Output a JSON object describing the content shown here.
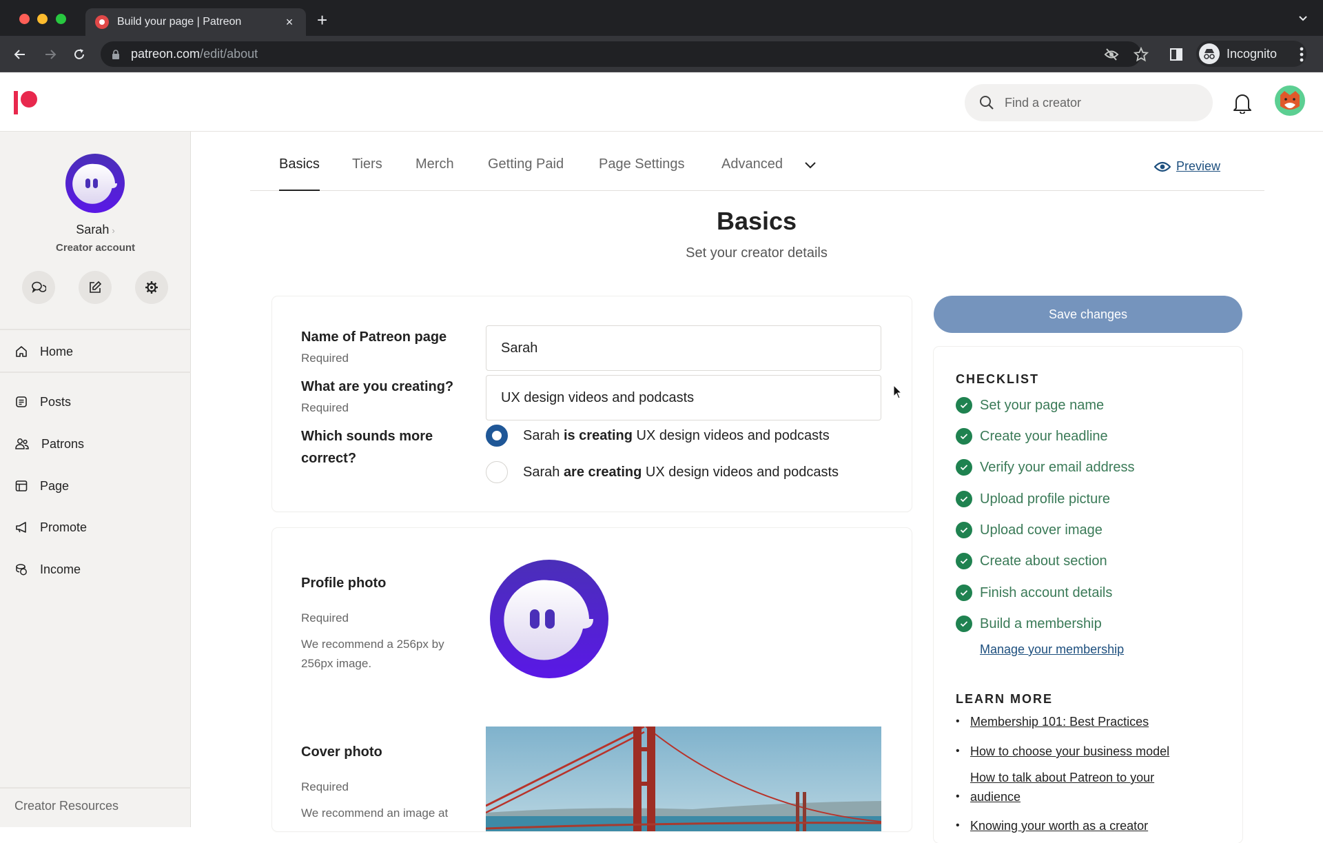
{
  "browser": {
    "tab_title": "Build your page | Patreon",
    "tab_close": "×",
    "new_tab": "+",
    "url_host": "patreon.com",
    "url_path": "/edit/about",
    "profile_label": "Incognito"
  },
  "header": {
    "search_placeholder": "Find a creator"
  },
  "sidebar": {
    "user_name": "Sarah",
    "name_chevron": "›",
    "account_type": "Creator account",
    "nav": [
      {
        "label": "Home",
        "icon": "home-icon"
      },
      {
        "label": "Posts",
        "icon": "posts-icon"
      },
      {
        "label": "Patrons",
        "icon": "patrons-icon"
      },
      {
        "label": "Page",
        "icon": "page-icon"
      },
      {
        "label": "Promote",
        "icon": "megaphone-icon"
      },
      {
        "label": "Income",
        "icon": "coins-icon"
      }
    ],
    "footer": "Creator Resources"
  },
  "tabs": {
    "items": [
      "Basics",
      "Tiers",
      "Merch",
      "Getting Paid",
      "Page Settings",
      "Advanced"
    ],
    "active": "Basics",
    "preview": "Preview"
  },
  "page": {
    "title": "Basics",
    "subtitle": "Set your creator details"
  },
  "form": {
    "name_label": "Name of Patreon page",
    "name_required": "Required",
    "name_value": "Sarah",
    "creating_label": "What are you creating?",
    "creating_required": "Required",
    "creating_value": "UX design videos and podcasts",
    "grammar_label": "Which sounds more correct?",
    "grammar_options": [
      {
        "pre": "Sarah ",
        "bold": "is creating",
        "post": " UX design videos and podcasts",
        "selected": true
      },
      {
        "pre": "Sarah ",
        "bold": "are creating",
        "post": " UX design videos and podcasts",
        "selected": false
      }
    ],
    "profile_label": "Profile photo",
    "profile_required": "Required",
    "profile_hint": "We recommend a 256px by 256px image.",
    "cover_label": "Cover photo",
    "cover_required": "Required",
    "cover_hint": "We recommend an image at"
  },
  "right": {
    "save_label": "Save changes",
    "checklist_heading": "CHECKLIST",
    "checklist": [
      "Set your page name",
      "Create your headline",
      "Verify your email address",
      "Upload profile picture",
      "Upload cover image",
      "Create about section",
      "Finish account details",
      "Build a membership"
    ],
    "manage_link": "Manage your membership",
    "learn_heading": "LEARN MORE",
    "learn_links": [
      "Membership 101: Best Practices",
      "How to choose your business model",
      "How to talk about Patreon to your audience",
      "Knowing your worth as a creator"
    ]
  },
  "colors": {
    "brand": "#e8284d",
    "link": "#1d4f7e",
    "radio_selected": "#1f5797",
    "checklist_green": "#1f8250",
    "save_button": "#7594bd",
    "avatar_purple": "#4a2bd6"
  }
}
